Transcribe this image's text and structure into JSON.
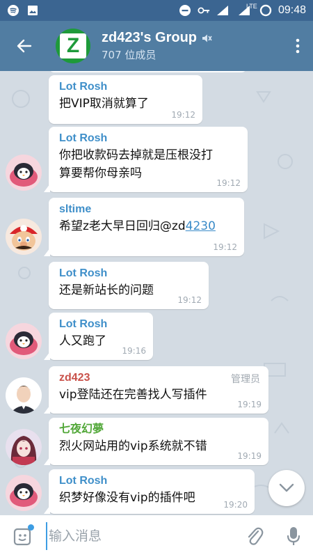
{
  "status_bar": {
    "time": "09:48",
    "network": "LTE",
    "icons": [
      "spotify-icon",
      "image-icon",
      "minus-circle-icon",
      "key-icon",
      "wifi-icon",
      "signal-icon",
      "battery-icon"
    ]
  },
  "header": {
    "title": "zd423's Group",
    "member_count": "707 位成员",
    "muted": true,
    "avatar_letter": "Z",
    "avatar_color": "#1e9a3a",
    "accent": "#517da2"
  },
  "messages": [
    {
      "sender": "Lot Rosh",
      "text": "把VIP取消就算了",
      "time": "19:12"
    },
    {
      "sender": "Lot Rosh",
      "text_line1": "你把收款码去掉就是压根没打",
      "text_line2": "算要帮你母亲吗",
      "time": "19:12"
    },
    {
      "sender": "sltime",
      "text": "希望z老大早日回归@zd",
      "link": "4230",
      "time": "19:12"
    },
    {
      "sender": "Lot Rosh",
      "text": "还是新站长的问题",
      "time": "19:12"
    },
    {
      "sender": "Lot Rosh",
      "text": "人又跑了",
      "time": "19:16"
    },
    {
      "sender": "zd423",
      "role": "管理员",
      "text": "vip登陆还在完善找人写插件",
      "time": "19:19"
    },
    {
      "sender": "七夜幻夢",
      "text": "烈火网站用的vip系统就不错",
      "time": "19:19"
    },
    {
      "sender": "Lot Rosh",
      "text": "织梦好像没有vip的插件吧",
      "time": "19:20"
    }
  ],
  "input": {
    "placeholder": "输入消息",
    "value": ""
  },
  "colors": {
    "sender_blue": "#3f8fc9",
    "sender_red": "#c9514a",
    "sender_green": "#53a83a",
    "chat_bg": "#d3dbe3"
  }
}
